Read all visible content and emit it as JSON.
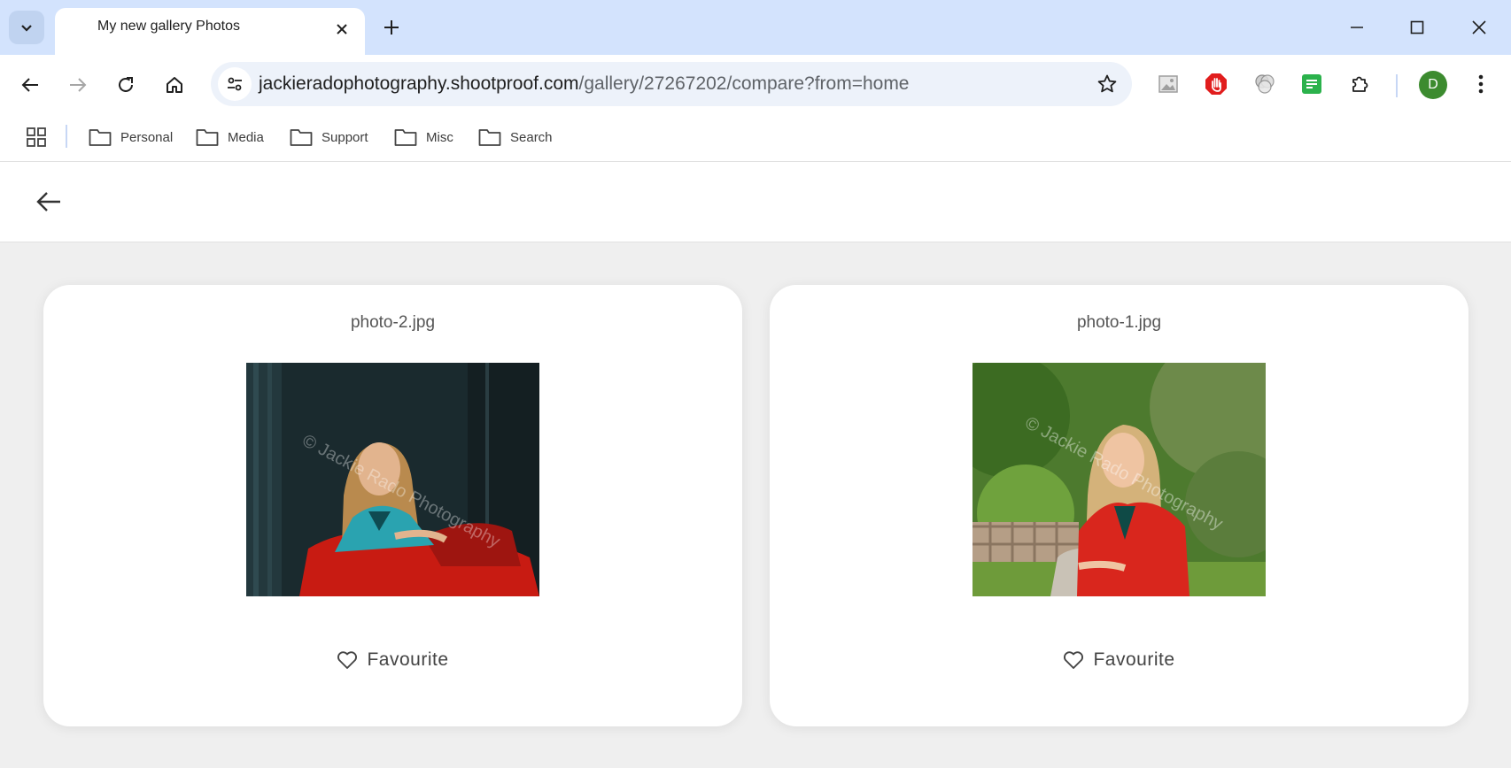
{
  "browser": {
    "tab_title": "My new gallery Photos",
    "url_host": "jackieradophotography.shootproof.com",
    "url_path": "/gallery/27267202/compare?from=home",
    "profile_initial": "D",
    "bookmarks": [
      "Personal",
      "Media",
      "Support",
      "Misc",
      "Search"
    ]
  },
  "compare": {
    "cards": [
      {
        "filename": "photo-2.jpg",
        "favourite_label": "Favourite"
      },
      {
        "filename": "photo-1.jpg",
        "favourite_label": "Favourite"
      }
    ],
    "watermark": "© Jackie Rado Photography"
  },
  "colors": {
    "tabstrip": "#d3e3fd",
    "page_bg": "#efefef",
    "avatar": "#3c8b2f"
  }
}
